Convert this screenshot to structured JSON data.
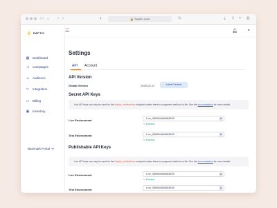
{
  "browser": {
    "url": "haptic.com"
  },
  "sidebar": {
    "brand": "HAPTIC",
    "items": [
      {
        "label": "Dashboard",
        "icon": "grid-icon"
      },
      {
        "label": "Campaigns",
        "icon": "megaphone-icon"
      },
      {
        "label": "Audience",
        "icon": "users-icon"
      },
      {
        "label": "Integration",
        "icon": "puzzle-icon"
      },
      {
        "label": "Billing",
        "icon": "card-icon"
      },
      {
        "label": "Inventory",
        "icon": "box-icon"
      }
    ],
    "portal_link": "Bluemark Portal"
  },
  "page": {
    "title": "Settings",
    "tabs": [
      "API",
      "Account"
    ],
    "active_tab": "API"
  },
  "api_version": {
    "title": "API Version",
    "label": "Global Version",
    "value": "2020-02-11",
    "button": "Latest Version"
  },
  "secret_keys": {
    "title": "Secret API Keys",
    "notice_pre": "Live API keys can only be used for the ",
    "notice_hl": "/haptic_verifications",
    "notice_mid": " endpoint unless there is a payment method on file. See the ",
    "notice_link": "documentation",
    "notice_post": " for more details.",
    "live_label": "Live Environment",
    "live_value": "Live_558584848483839",
    "test_label": "Test Environment",
    "test_value": "Live_558584848483839",
    "refresh": "Refresh"
  },
  "publishable_keys": {
    "title": "Publishable API Keys",
    "notice_pre": "Live API keys can only be used for the ",
    "notice_hl": "/haptic_verifications",
    "notice_mid": " endpoint unless there is a payment method on file. See the ",
    "notice_link": "documentation",
    "notice_post": " for more details.",
    "live_label": "Live Environment",
    "live_value": "Live_558584848483839",
    "test_label": "Test Environment",
    "test_value": "Live_558584848483839",
    "refresh": "Refresh"
  },
  "colors": {
    "accent": "#ff6a1a",
    "nav": "#2a3b8f",
    "refresh": "#2d9c8a",
    "background": "#f6ebe4"
  }
}
